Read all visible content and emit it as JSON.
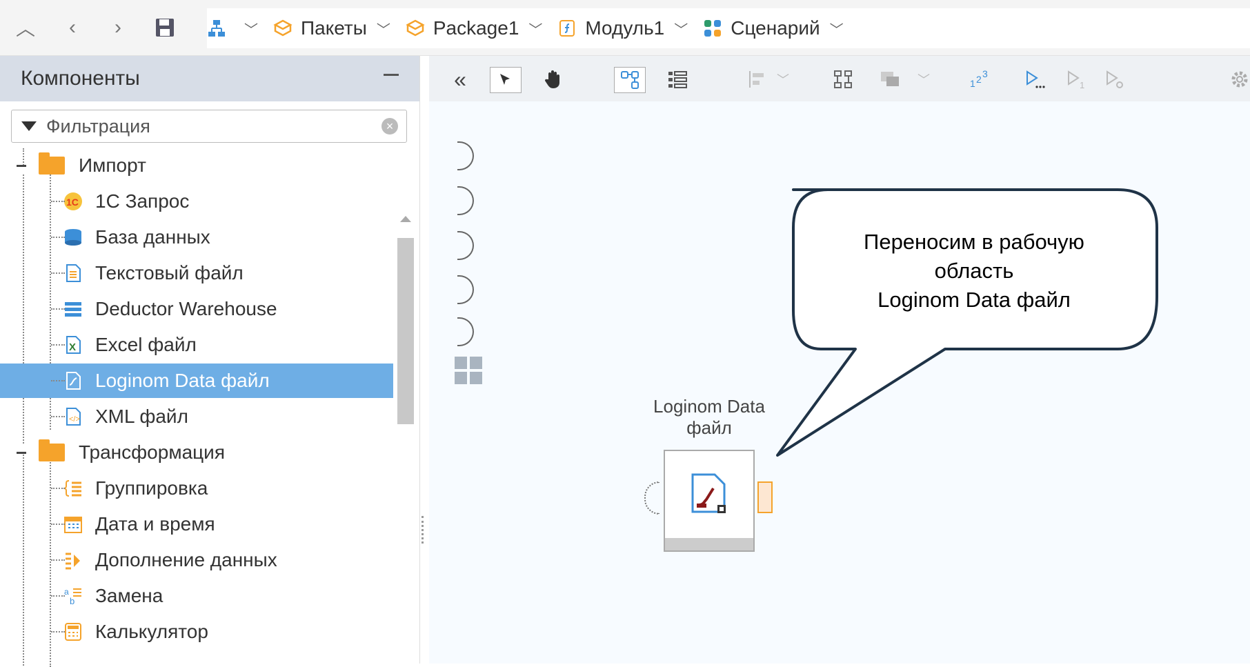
{
  "toolbar_top": {
    "breadcrumbs": [
      {
        "label": "",
        "icon": "hierarchy-icon"
      },
      {
        "label": "Пакеты",
        "icon": "package-icon"
      },
      {
        "label": "Package1",
        "icon": "package-icon"
      },
      {
        "label": "Модуль1",
        "icon": "module-icon"
      },
      {
        "label": "Сценарий",
        "icon": "scenario-icon"
      }
    ]
  },
  "components_panel": {
    "title": "Компоненты",
    "filter_placeholder": "Фильтрация",
    "groups": [
      {
        "label": "Импорт"
      },
      {
        "label": "Трансформация"
      }
    ],
    "import_items": [
      {
        "label": "1С Запрос",
        "icon": "1c-icon",
        "color": "#e63b1a"
      },
      {
        "label": "База данных",
        "icon": "database-icon",
        "color": "#3c8fd8"
      },
      {
        "label": "Текстовый файл",
        "icon": "text-file-icon",
        "color": "#3c8fd8"
      },
      {
        "label": "Deductor Warehouse",
        "icon": "warehouse-icon",
        "color": "#3c8fd8"
      },
      {
        "label": "Excel файл",
        "icon": "excel-file-icon",
        "color": "#2e7d32"
      },
      {
        "label": "Loginom Data файл",
        "icon": "loginom-data-file-icon",
        "color": "#3c8fd8",
        "selected": true
      },
      {
        "label": "XML файл",
        "icon": "xml-file-icon",
        "color": "#3c8fd8"
      }
    ],
    "transform_items": [
      {
        "label": "Группировка",
        "icon": "grouping-icon",
        "color": "#f5a32b"
      },
      {
        "label": "Дата и время",
        "icon": "calendar-icon",
        "color": "#f5a32b"
      },
      {
        "label": "Дополнение данных",
        "icon": "data-supplement-icon",
        "color": "#f5a32b"
      },
      {
        "label": "Замена",
        "icon": "replace-icon",
        "color": "#f5a32b"
      },
      {
        "label": "Калькулятор",
        "icon": "calculator-icon",
        "color": "#f5a32b"
      }
    ]
  },
  "canvas": {
    "node": {
      "title_line1": "Loginom Data",
      "title_line2": "файл"
    },
    "callout": {
      "line1": "Переносим в рабочую",
      "line2": "область",
      "line3": "Loginom Data файл"
    }
  },
  "colors": {
    "selection": "#6eaee5",
    "accent_orange": "#f5a32b",
    "callout_border": "#1f3347"
  }
}
